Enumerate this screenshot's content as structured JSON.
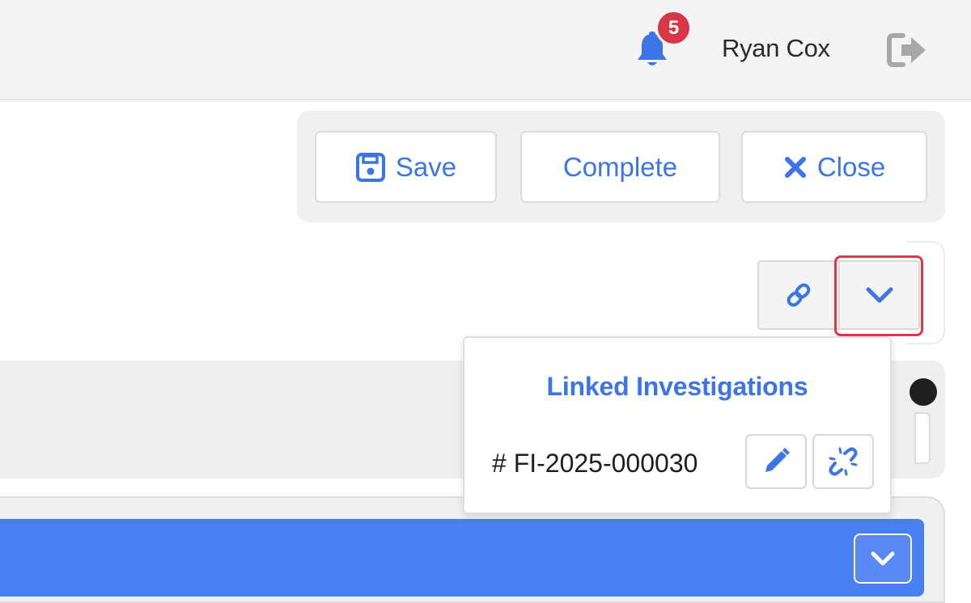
{
  "header": {
    "notification_count": "5",
    "user_name": "Ryan Cox"
  },
  "toolbar": {
    "save_label": "Save",
    "complete_label": "Complete",
    "close_label": "Close"
  },
  "linked_investigations": {
    "title": "Linked Investigations",
    "items": [
      {
        "id": "# FI-2025-000030"
      }
    ]
  },
  "colors": {
    "accent": "#3d75e6",
    "badge": "#d9364a",
    "highlight": "#e0374d",
    "bar": "#4a7ff3"
  },
  "icons": {
    "notifications": "bell-icon",
    "logout": "logout-icon",
    "save": "floppy-disk-icon",
    "close": "x-icon",
    "link": "link-icon",
    "expand": "chevron-down-icon",
    "edit": "pencil-icon",
    "unlink": "broken-link-icon"
  }
}
